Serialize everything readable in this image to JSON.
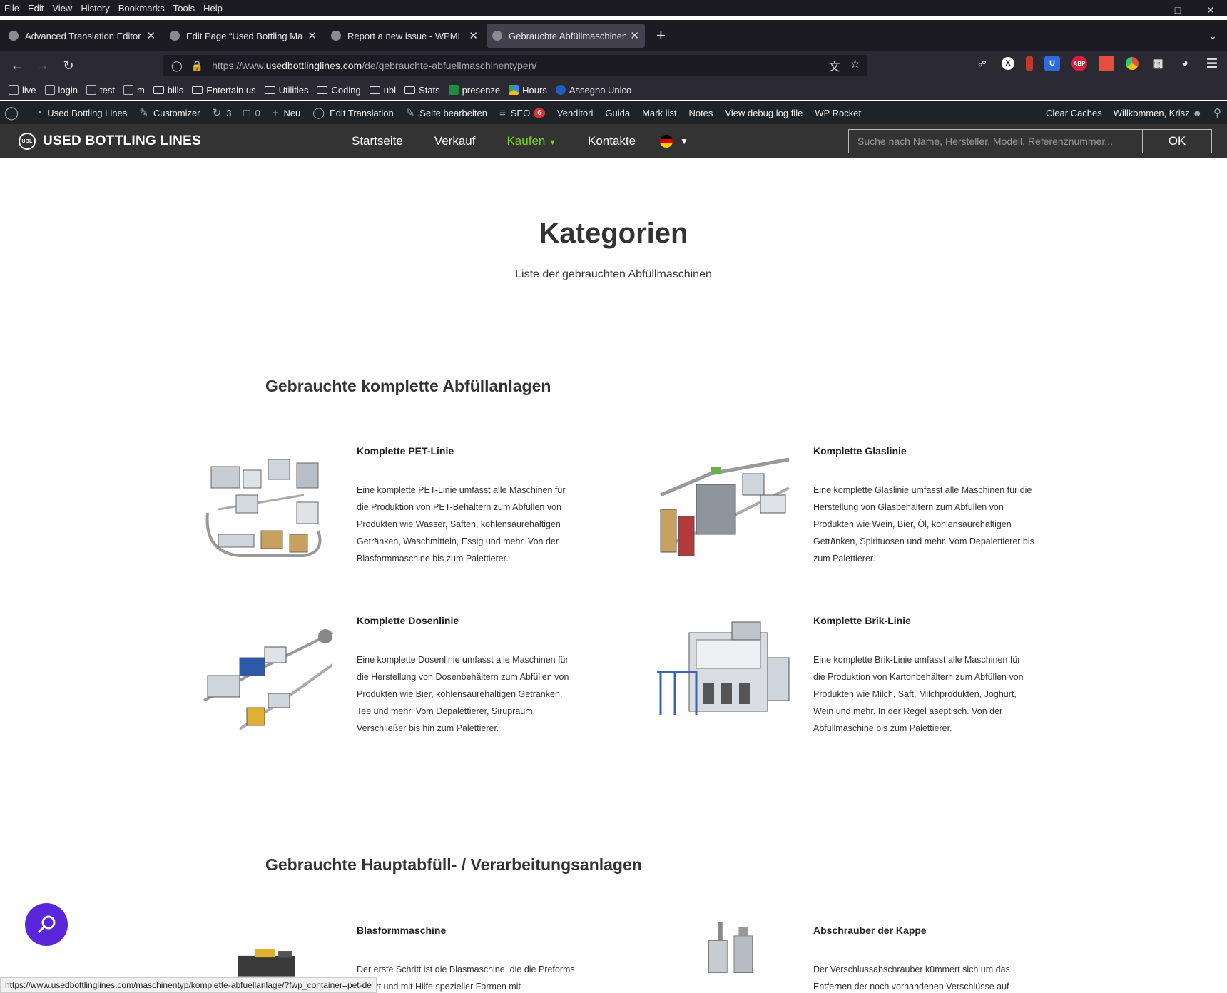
{
  "menubar": {
    "items": [
      "File",
      "Edit",
      "View",
      "History",
      "Bookmarks",
      "Tools",
      "Help"
    ]
  },
  "tabs": [
    {
      "label": "Advanced Translation Editor - W"
    },
    {
      "label": "Edit Page “Used Bottling Machi"
    },
    {
      "label": "Report a new issue - WPML"
    },
    {
      "label": "Gebrauchte Abfüllmaschinentyp"
    }
  ],
  "url": {
    "prefix": "https://www.",
    "host": "usedbottlinglines.com",
    "path": "/de/gebrauchte-abfuellmaschinentypen/"
  },
  "bookmarks": [
    "live",
    "login",
    "test",
    "m",
    "bills",
    "Entertain us",
    "Utilities",
    "Coding",
    "ubl",
    "Stats",
    "presenze",
    "Hours",
    "Assegno Unico"
  ],
  "wpbar": {
    "site": "Used Bottling Lines",
    "customizer": "Customizer",
    "updates": "3",
    "comments": "0",
    "new": "Neu",
    "edit_translation": "Edit Translation",
    "edit_page": "Seite bearbeiten",
    "seo": "SEO",
    "seo_badge": "6",
    "links": [
      "Venditori",
      "Guida",
      "Mark list",
      "Notes",
      "View debug.log file",
      "WP Rocket"
    ],
    "clear_caches": "Clear Caches",
    "welcome": "Willkommen, Krisz"
  },
  "header": {
    "logo": "USED BOTTLING LINES",
    "logo_badge": "UBL",
    "nav": [
      "Startseite",
      "Verkauf",
      "Kaufen",
      "Kontakte"
    ],
    "search_placeholder": "Suche nach Name, Hersteller, Modell, Referenznummer...",
    "search_button": "OK"
  },
  "page": {
    "title": "Kategorien",
    "subtitle": "Liste der gebrauchten Abfüllmaschinen",
    "section1": "Gebrauchte komplette Abfüllanlagen",
    "section2": "Gebrauchte Hauptabfüll- / Verarbeitungsanlagen",
    "cards": [
      {
        "title": "Komplette PET-Linie",
        "text": "Eine komplette PET-Linie umfasst alle Maschinen für die Produktion von PET-Behältern zum Abfüllen von Produkten wie Wasser, Säften, kohlensäurehaltigen Getränken, Waschmitteln, Essig und mehr. Von der Blasformmaschine bis zum Palettierer."
      },
      {
        "title": "Komplette Glaslinie",
        "text": "Eine komplette Glaslinie umfasst alle Maschinen für die Herstellung von Glasbehältern zum Abfüllen von Produkten wie Wein, Bier, Öl, kohlensäurehaltigen Getränken, Spirituosen und mehr. Vom Depalettierer bis zum Palettierer."
      },
      {
        "title": "Komplette Dosenlinie",
        "text": "Eine komplette Dosenlinie umfasst alle Maschinen für die Herstellung von Dosenbehältern zum Abfüllen von Produkten wie Bier, kohlensäurehaltigen Getränken, Tee und mehr. Vom Depalettierer, Sirupraum, Verschließer bis hin zum Palettierer."
      },
      {
        "title": "Komplette Brik-Linie",
        "text": "Eine komplette Brik-Linie umfasst alle Maschinen für die Produktion von Kartonbehältern zum Abfüllen von Produkten wie Milch, Saft, Milchprodukten, Joghurt, Wein und mehr. In der Regel aseptisch. Von der Abfüllmaschine bis zum Palettierer."
      },
      {
        "title": "Blasformmaschine",
        "text": "Der erste Schritt ist die Blasmaschine, die die Preforms erhitzt und mit Hilfe spezieller Formen mit"
      },
      {
        "title": "Abschrauber der Kappe",
        "text": "Der Verschlussabschrauber kümmert sich um das Entfernen der noch vorhandenen Verschlüsse auf"
      }
    ]
  },
  "status_url": "https://www.usedbottlinglines.com/maschinentyp/komplette-abfuellanlage/?fwp_container=pet-de",
  "colors": {
    "accent_nav": "#7ed321",
    "header_bg": "#333333",
    "fab": "#5a26d9",
    "wp_bar": "#1d2327"
  }
}
